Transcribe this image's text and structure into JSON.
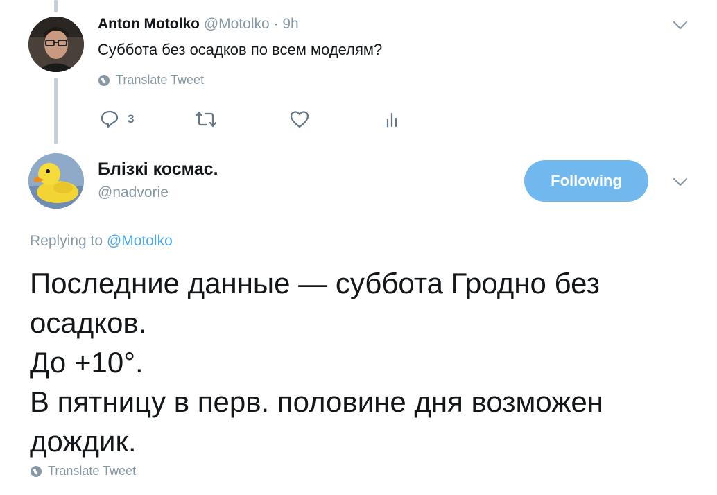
{
  "reply_tweet": {
    "author_name": "Anton Motolko",
    "author_handle": "@Motolko",
    "separator": "·",
    "time": "9h",
    "text": "Суббота без осадков по всем моделям?",
    "translate_label": "Translate Tweet",
    "actions": {
      "reply_count": "3",
      "reply_icon": "reply-icon",
      "retweet_icon": "retweet-icon",
      "like_icon": "heart-icon",
      "analytics_icon": "analytics-icon"
    }
  },
  "main_tweet": {
    "author_name": "Блізкі космас.",
    "author_handle": "@nadvorie",
    "follow_button_label": "Following",
    "replying_prefix": "Replying to",
    "replying_mention": "@Motolko",
    "text": "Последние данные — суббота Гродно без осадков.\nДо +10°.\nВ пятницу в перв. половине дня возможен дождик.",
    "translate_label": "Translate Tweet"
  },
  "colors": {
    "accent": "#71b8ef",
    "mention": "#4da6e9",
    "secondary_text": "#8899a6",
    "thread_line": "#c4cfd6"
  }
}
